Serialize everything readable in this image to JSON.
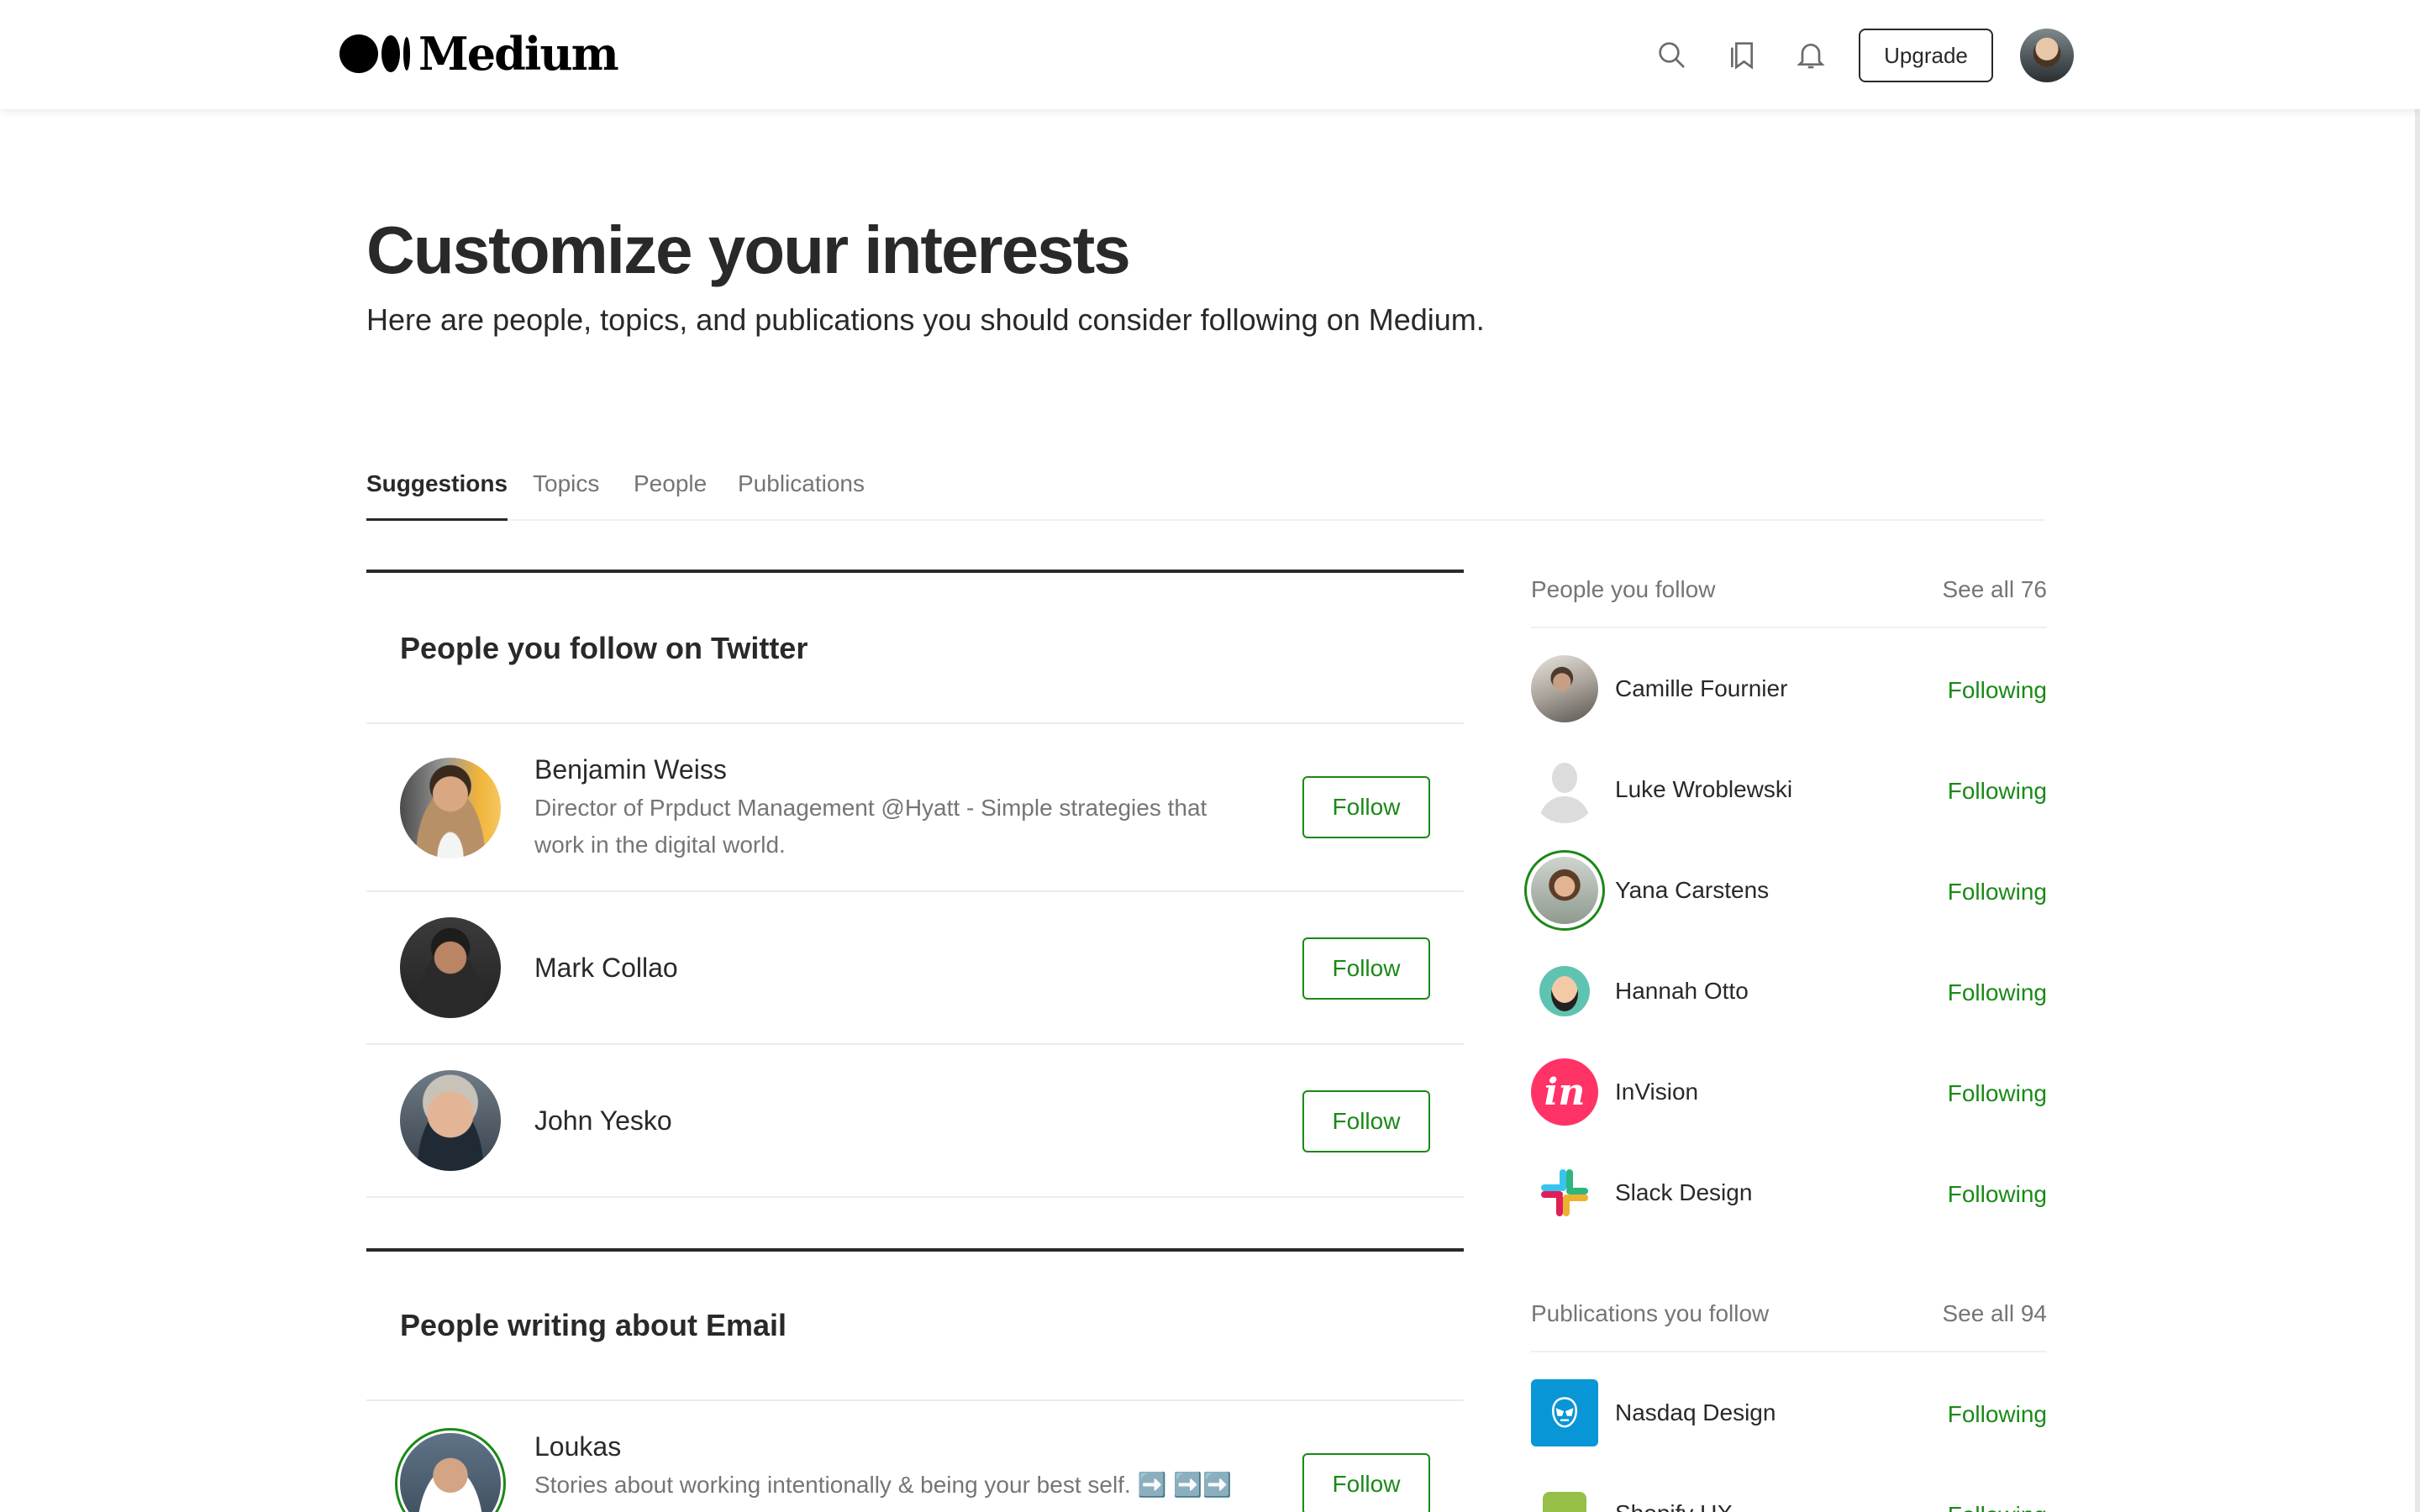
{
  "header": {
    "logo_text": "Medium",
    "upgrade_label": "Upgrade",
    "icons": [
      "search-icon",
      "bookmarks-icon",
      "bell-icon"
    ]
  },
  "intro": {
    "title": "Customize your interests",
    "subtitle": "Here are people, topics, and publications you should consider following on Medium."
  },
  "tabs": [
    {
      "label": "Suggestions",
      "active": true
    },
    {
      "label": "Topics",
      "active": false
    },
    {
      "label": "People",
      "active": false
    },
    {
      "label": "Publications",
      "active": false
    }
  ],
  "sections": [
    {
      "title": "People you follow on Twitter",
      "people": [
        {
          "name": "Benjamin Weiss",
          "bio": "Director of Prpduct Management @Hyatt - Simple strategies that work in the digital world.",
          "button": "Follow"
        },
        {
          "name": "Mark Collao",
          "bio": "",
          "button": "Follow"
        },
        {
          "name": "John Yesko",
          "bio": "",
          "button": "Follow"
        }
      ]
    },
    {
      "title": "People writing about Email",
      "people": [
        {
          "name": "Loukas",
          "bio": "Stories about working intentionally & being your best self. ➡️ ➡️➡️",
          "button": "Follow"
        }
      ]
    }
  ],
  "sidebar": {
    "people": {
      "heading": "People you follow",
      "see_all": "See all 76",
      "items": [
        {
          "name": "Camille Fournier",
          "status": "Following"
        },
        {
          "name": "Luke Wroblewski",
          "status": "Following"
        },
        {
          "name": "Yana Carstens",
          "status": "Following"
        },
        {
          "name": "Hannah Otto",
          "status": "Following"
        },
        {
          "name": "InVision",
          "status": "Following",
          "logo_text": "in"
        },
        {
          "name": "Slack Design",
          "status": "Following"
        }
      ]
    },
    "publications": {
      "heading": "Publications you follow",
      "see_all": "See all 94",
      "items": [
        {
          "name": "Nasdaq Design",
          "status": "Following"
        },
        {
          "name": "Shopify UX",
          "status": "Following"
        }
      ]
    }
  },
  "colors": {
    "accent_green": "#1a8917",
    "text_primary": "#292929",
    "text_secondary": "#757575",
    "invision_pink": "#ff3366"
  }
}
